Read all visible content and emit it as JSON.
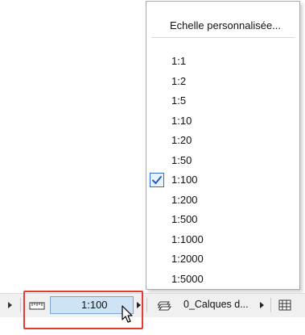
{
  "menu": {
    "custom_scale": "Echelle personnalisée...",
    "items": [
      {
        "label": "1:1",
        "checked": false
      },
      {
        "label": "1:2",
        "checked": false
      },
      {
        "label": "1:5",
        "checked": false
      },
      {
        "label": "1:10",
        "checked": false
      },
      {
        "label": "1:20",
        "checked": false
      },
      {
        "label": "1:50",
        "checked": false
      },
      {
        "label": "1:100",
        "checked": true
      },
      {
        "label": "1:200",
        "checked": false
      },
      {
        "label": "1:500",
        "checked": false
      },
      {
        "label": "1:1000",
        "checked": false
      },
      {
        "label": "1:2000",
        "checked": false
      },
      {
        "label": "1:5000",
        "checked": false
      }
    ]
  },
  "statusbar": {
    "scale_value": "1:100",
    "layers_label": "0_Calques d..."
  },
  "colors": {
    "highlight": "#e53935",
    "selected_field": "#cfe3f7",
    "check_accent": "#2d6fd6"
  },
  "icons": {
    "ruler": "ruler-icon",
    "layers": "layers-icon",
    "model_view": "model-view-icon",
    "check": "check-icon",
    "cursor": "cursor-icon"
  }
}
